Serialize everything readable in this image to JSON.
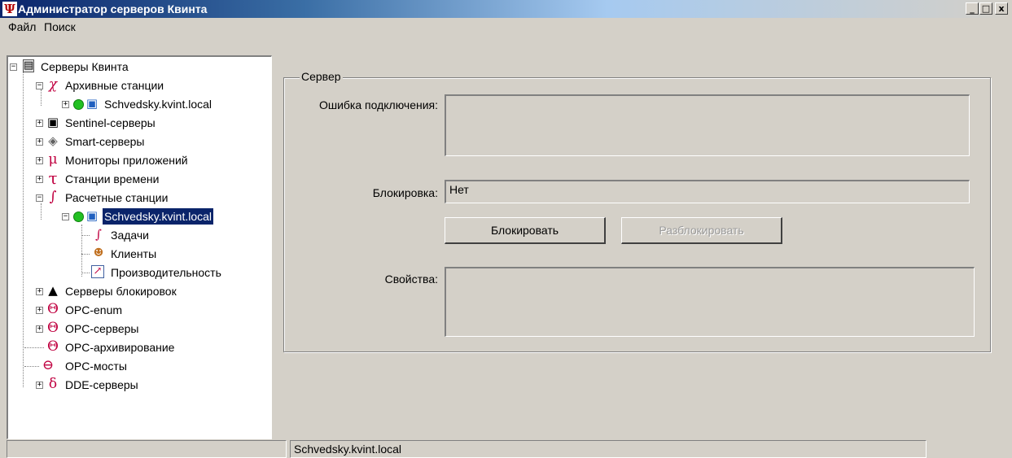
{
  "window": {
    "title": "Администратор серверов Квинта",
    "app_icon": "Ψ",
    "controls": {
      "minimize": "_",
      "maximize": "□",
      "close": "x"
    }
  },
  "menu": {
    "file": "Файл",
    "search": "Поиск"
  },
  "tree": {
    "root": "Серверы Квинта",
    "archive": "Архивные станции",
    "archive_host": "Schvedsky.kvint.local",
    "sentinel": "Sentinel-серверы",
    "smart": "Smart-серверы",
    "monitors": "Мониторы приложений",
    "time": "Станции времени",
    "calc": "Расчетные станции",
    "calc_host": "Schvedsky.kvint.local",
    "tasks": "Задачи",
    "clients": "Клиенты",
    "perf": "Производительность",
    "lock_servers": "Серверы блокировок",
    "opc_enum": "OPC-enum",
    "opc_servers": "OPC-серверы",
    "opc_archiving": "OPC-архивирование",
    "opc_bridges": "OPC-мосты",
    "dde": "DDE-серверы",
    "glyphs": {
      "archive": "χ",
      "monitors": "μ",
      "time": "τ",
      "calc": "∫",
      "opc": "Θ",
      "dde": "δ"
    }
  },
  "server_panel": {
    "group_title": "Сервер",
    "error_label": "Ошибка подключения:",
    "error_value": "",
    "lock_label": "Блокировка:",
    "lock_value": "Нет",
    "lock_button": "Блокировать",
    "unlock_button": "Разблокировать",
    "props_label": "Свойства:",
    "props_value": ""
  },
  "statusbar": {
    "left": "",
    "right": "Schvedsky.kvint.local"
  },
  "colors": {
    "accent_red": "#c00040",
    "selection": "#0a246a",
    "online": "#22c022"
  }
}
